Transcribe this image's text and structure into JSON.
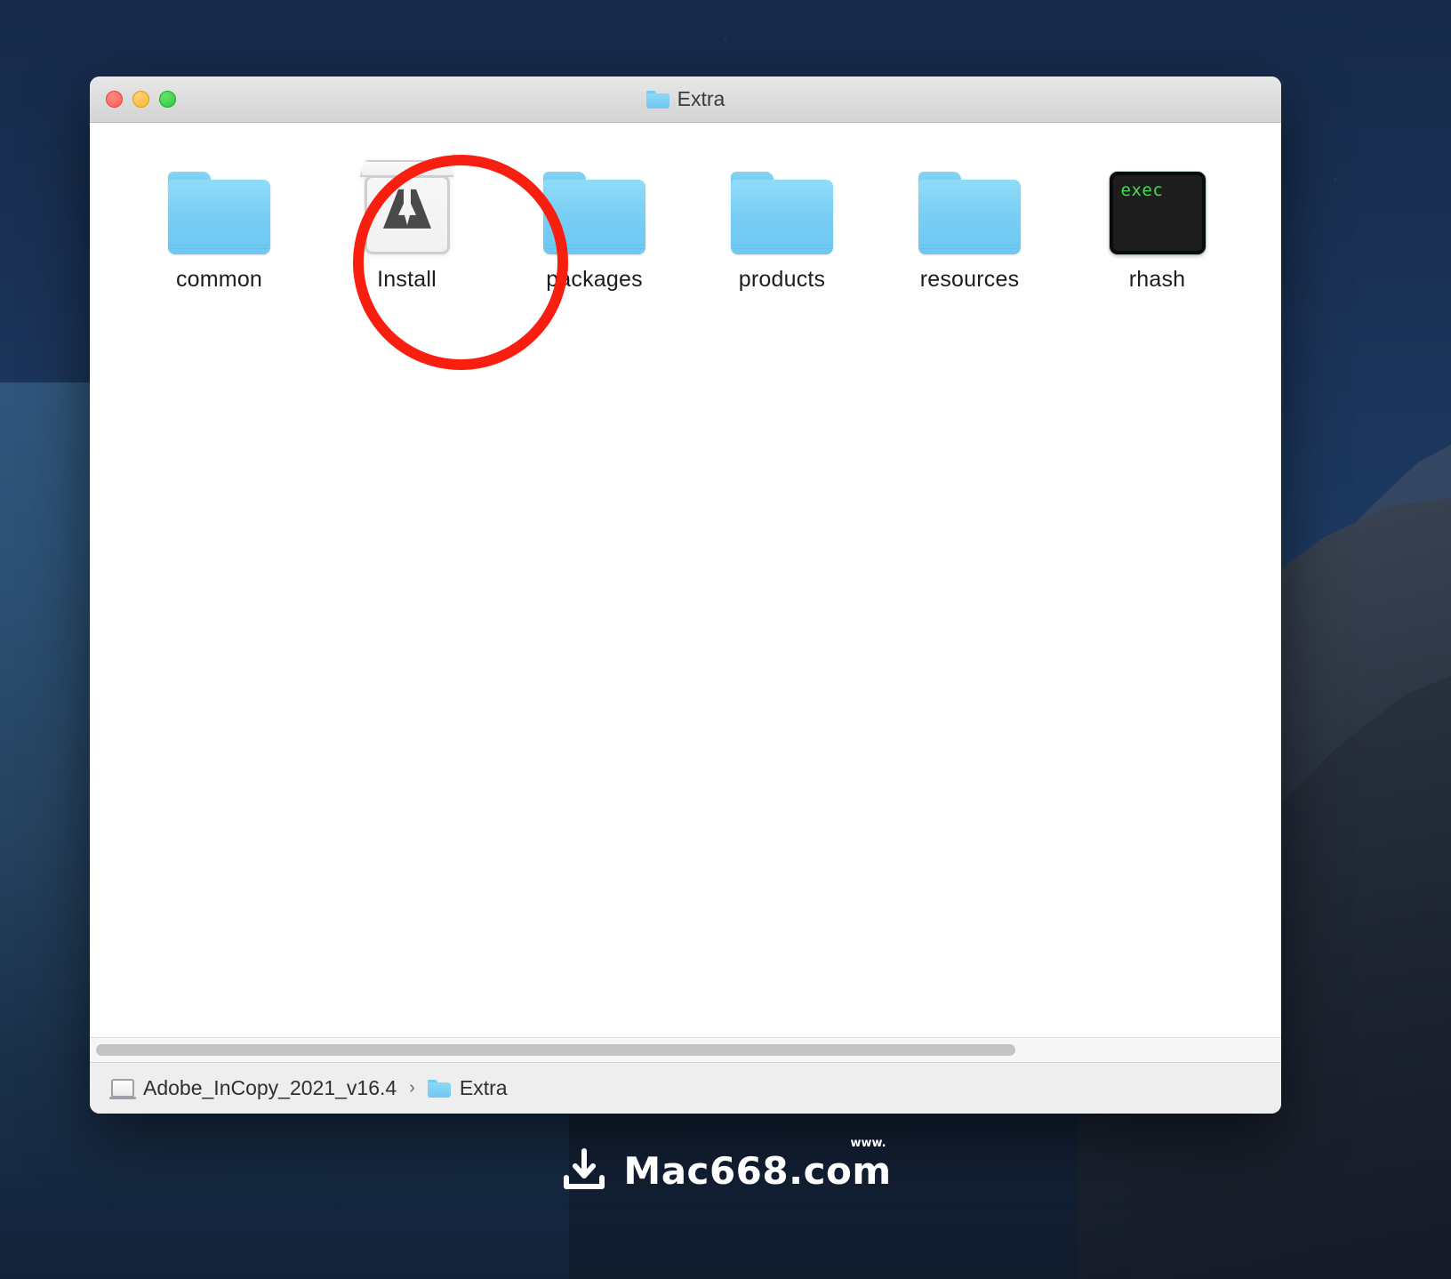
{
  "window": {
    "title": "Extra",
    "title_icon": "folder-icon",
    "traffic_lights": [
      {
        "name": "close",
        "color": "#FC5D54"
      },
      {
        "name": "minimize",
        "color": "#FEB92E"
      },
      {
        "name": "maximize",
        "color": "#27C83F"
      }
    ]
  },
  "items": [
    {
      "name": "common",
      "label": "common",
      "kind": "folder",
      "icon": "folder-icon"
    },
    {
      "name": "install",
      "label": "Install",
      "kind": "package",
      "icon": "adobe-installer-package-icon",
      "highlighted": true
    },
    {
      "name": "packages",
      "label": "packages",
      "kind": "folder",
      "icon": "folder-icon"
    },
    {
      "name": "products",
      "label": "products",
      "kind": "folder",
      "icon": "folder-icon"
    },
    {
      "name": "resources",
      "label": "resources",
      "kind": "folder",
      "icon": "folder-icon"
    },
    {
      "name": "rhash",
      "label": "rhash",
      "kind": "unix-executable",
      "icon": "terminal-exec-icon",
      "icon_text": "exec"
    }
  ],
  "annotation": {
    "shape": "circle",
    "color": "#F91F10",
    "target": "Install"
  },
  "scrollbar": {
    "orientation": "horizontal",
    "thumb_percent": 78
  },
  "pathbar": {
    "crumbs": [
      {
        "label": "Adobe_InCopy_2021_v16.4",
        "icon": "disk-icon"
      },
      {
        "label": "Extra",
        "icon": "folder-icon"
      }
    ],
    "separator": "›"
  },
  "watermark": {
    "icon": "download-icon",
    "text": "Mac668.com",
    "superscript": "www."
  },
  "colors": {
    "folder_blue": "#79CEF4",
    "accent_red": "#F91F10",
    "exec_green": "#3EE04C",
    "titlebar_gray": "#DCDCDC",
    "pathbar_gray": "#EEEEEE"
  }
}
